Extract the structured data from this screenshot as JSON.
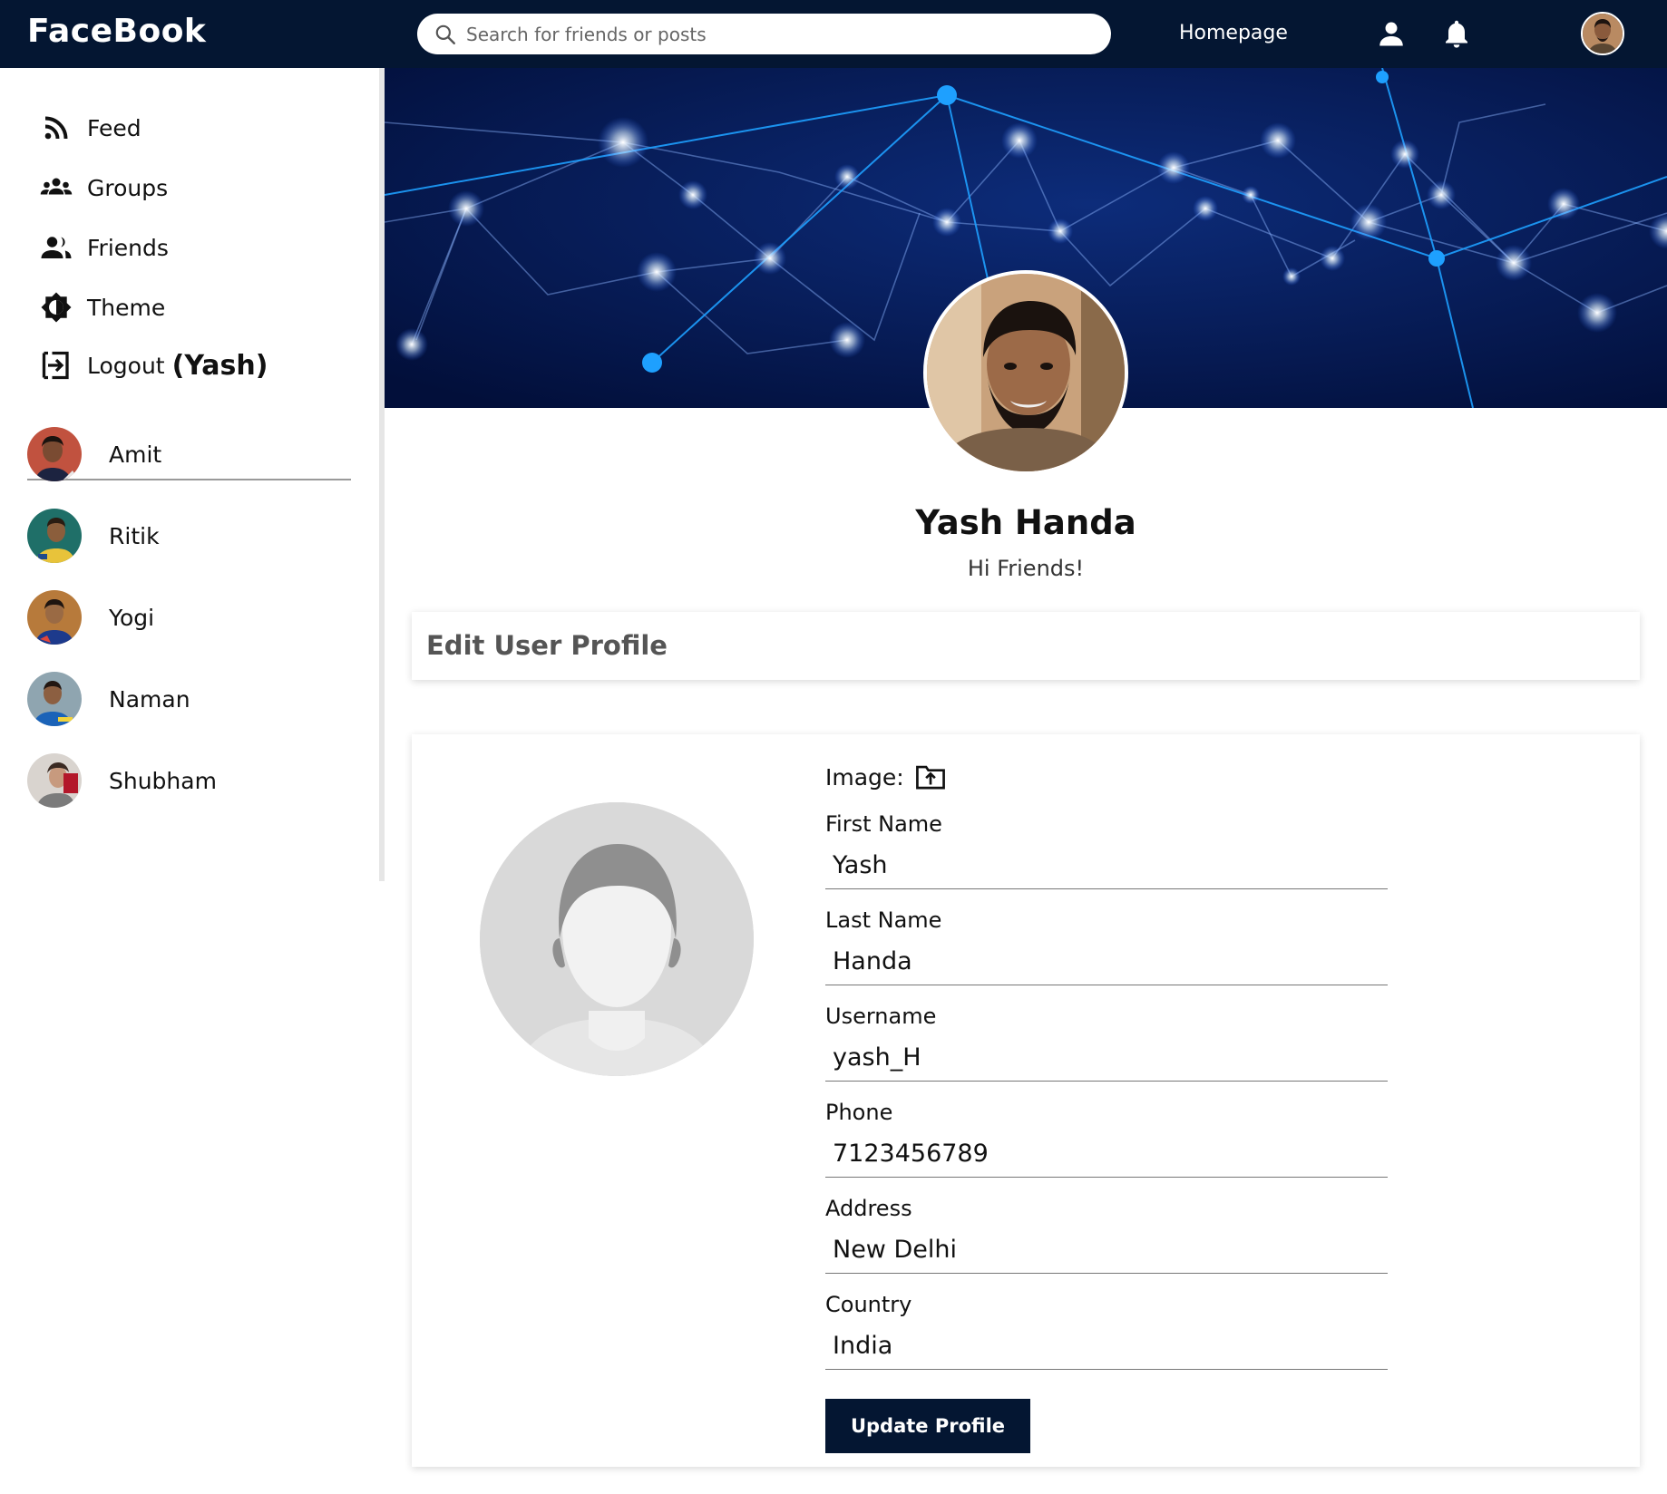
{
  "header": {
    "logo": "FaceBook",
    "search_placeholder": "Search for friends or posts",
    "nav_link": "Homepage",
    "icons": [
      "search-icon",
      "person-icon",
      "bell-icon"
    ]
  },
  "sidebar": {
    "menu": [
      {
        "label": "Feed",
        "icon": "rss-icon"
      },
      {
        "label": "Groups",
        "icon": "groups-icon"
      },
      {
        "label": "Friends",
        "icon": "friends-icon"
      },
      {
        "label": "Theme",
        "icon": "brightness-icon"
      },
      {
        "label": "Logout",
        "icon": "logout-icon"
      }
    ],
    "logout_user": "(Yash)",
    "friends": [
      {
        "name": "Amit"
      },
      {
        "name": "Ritik"
      },
      {
        "name": "Yogi"
      },
      {
        "name": "Naman"
      },
      {
        "name": "Shubham"
      }
    ]
  },
  "profile": {
    "name": "Yash Handa",
    "status": "Hi Friends!"
  },
  "edit": {
    "title": "Edit User Profile",
    "image_label": "Image:",
    "fields": [
      {
        "label": "First Name",
        "value": "Yash"
      },
      {
        "label": "Last Name",
        "value": "Handa"
      },
      {
        "label": "Username",
        "value": "yash_H"
      },
      {
        "label": "Phone",
        "value": "7123456789"
      },
      {
        "label": "Address",
        "value": "New Delhi"
      },
      {
        "label": "Country",
        "value": "India"
      }
    ],
    "submit": "Update Profile"
  },
  "colors": {
    "navbar": "#041632",
    "cover": "#02154a",
    "button": "#041632"
  }
}
